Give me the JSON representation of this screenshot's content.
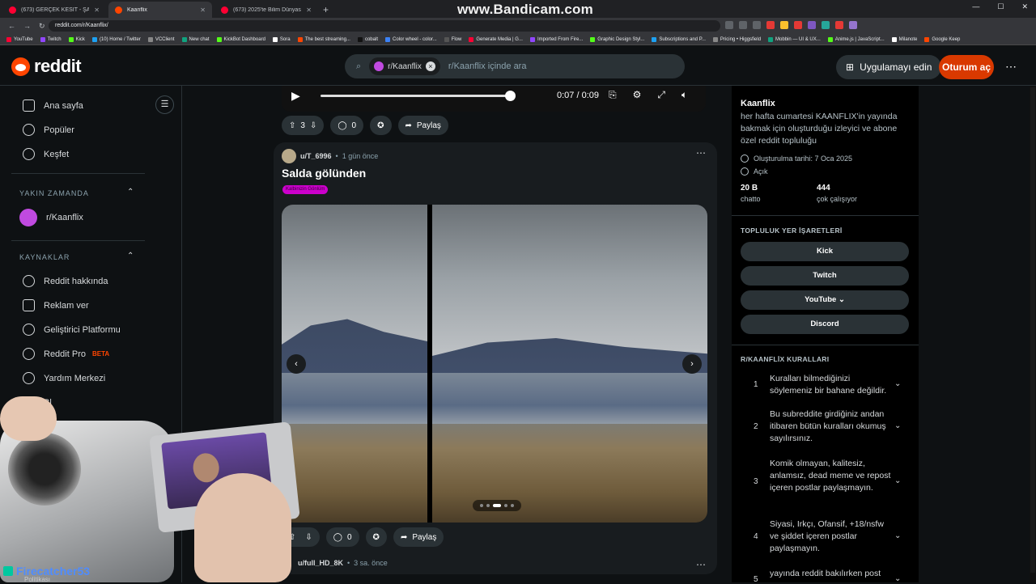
{
  "browser": {
    "tabs": [
      {
        "title": "(673) GERÇEK KESİT - ŞARKICI"
      },
      {
        "title": "Kaanflix"
      },
      {
        "title": "(673) 2025'te Bilim Dünyasını S"
      }
    ],
    "active_tab": 1,
    "url": "reddit.com/r/Kaanflix/",
    "watermark": "www.Bandicam.com",
    "bookmarks": [
      "YouTube",
      "Twitch",
      "Kick",
      "(10) Home / Twitter",
      "VCClient",
      "New chat",
      "KickBot Dashboard",
      "Sora",
      "The best streaming...",
      "cobalt",
      "Color wheel - color...",
      "Flow",
      "Generate Media | G...",
      "Imported From Fire...",
      "Graphic Design Styl...",
      "Subscriptions and P...",
      "Pricing • Higgsfield",
      "Mobbin — UI & UX...",
      "Anime.js | JavaScript...",
      "Milanote",
      "Google Keep"
    ]
  },
  "header": {
    "logo": "reddit",
    "search_chip": "r/Kaanflix",
    "search_placeholder": "r/Kaanflix içinde ara",
    "get_app": "Uygulamayı edin",
    "login": "Oturum aç"
  },
  "sidebar": {
    "top": [
      {
        "label": "Ana sayfa",
        "icon": "home-icon"
      },
      {
        "label": "Popüler",
        "icon": "popular-icon"
      },
      {
        "label": "Keşfet",
        "icon": "explore-icon"
      }
    ],
    "recent_title": "YAKIN ZAMANDA",
    "recent": [
      {
        "label": "r/Kaanflix"
      }
    ],
    "resources_title": "KAYNAKLAR",
    "resources": [
      {
        "label": "Reddit hakkında",
        "icon": "reddit-icon"
      },
      {
        "label": "Reklam ver",
        "icon": "megaphone-icon"
      },
      {
        "label": "Geliştirici Platformu",
        "icon": "developer-icon"
      },
      {
        "label": "Reddit Pro",
        "icon": "pro-icon",
        "badge": "BETA"
      },
      {
        "label": "Yardım Merkezi",
        "icon": "help-icon"
      },
      {
        "label": "Bl",
        "icon": "book-icon"
      }
    ]
  },
  "feed": {
    "video": {
      "time": "0:07 / 0:09",
      "progress": 0.78
    },
    "post1_actions": {
      "votes": "3",
      "comments": "0",
      "share": "Paylaş"
    },
    "post2": {
      "user": "u/T_6996",
      "time": "1 gün önce",
      "title": "Salda gölünden",
      "flair": "Kalbinizin Gönlüm",
      "votes": "",
      "comments": "0",
      "share": "Paylaş",
      "slide_count": 5,
      "active_slide": 2
    },
    "post3": {
      "user": "u/full_HD_8K",
      "time": "3 sa. önce"
    }
  },
  "community": {
    "name": "Kaanflix",
    "description": "her hafta cumartesi KAANFLIX'in yayında bakmak için oluşturduğu izleyici ve abone özel reddit topluluğu",
    "created": "Oluşturulma tarihi: 7 Oca 2025",
    "visibility": "Açık",
    "stats": [
      {
        "value": "20 B",
        "label": "chatto"
      },
      {
        "value": "444",
        "label": "çok çalışıyor"
      }
    ],
    "bookmarks_title": "TOPLULUK YER İŞARETLERİ",
    "bookmarks": [
      "Kick",
      "Twitch",
      "YouTube",
      "Discord"
    ],
    "rules_title": "R/KAANFLİX KURALLARI",
    "rules": [
      {
        "num": "1",
        "text": "Kuralları bilmediğinizi söylemeniz bir bahane değildir."
      },
      {
        "num": "2",
        "text": "Bu subreddite girdiğiniz andan itibaren bütün kuralları okumuş sayılırsınız."
      },
      {
        "num": "3",
        "text": "Komik olmayan, kalitesiz, anlamsız, dead meme ve repost içeren postlar paylaşmayın."
      },
      {
        "num": "4",
        "text": "Siyasi, Irkçı, Ofansif, +18/nsfw ve şiddet içeren postlar paylaşmayın."
      },
      {
        "num": "5",
        "text": "yayında reddit bakılırken post"
      }
    ]
  },
  "overlay": {
    "chat_user": "Firecatcher53",
    "chat_msg": "Politikası"
  },
  "colors": {
    "brand": "#ff4500",
    "login": "#d93900",
    "flair": "#cc00cc",
    "bg": "#0e1113"
  }
}
